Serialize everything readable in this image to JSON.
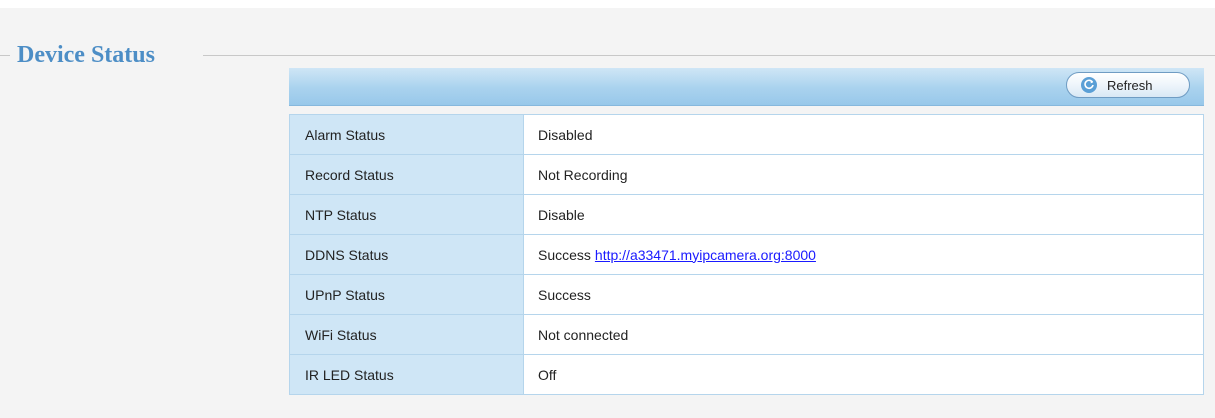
{
  "section": {
    "title": "Device Status"
  },
  "toolbar": {
    "refresh_label": "Refresh",
    "refresh_icon": "refresh-icon"
  },
  "status_rows": [
    {
      "label": "Alarm Status",
      "value": "Disabled"
    },
    {
      "label": "Record Status",
      "value": "Not Recording"
    },
    {
      "label": "NTP Status",
      "value": "Disable"
    },
    {
      "label": "DDNS Status",
      "value": "Success",
      "link": "http://a33471.myipcamera.org:8000"
    },
    {
      "label": "UPnP Status",
      "value": "Success"
    },
    {
      "label": "WiFi Status",
      "value": "Not connected"
    },
    {
      "label": "IR LED Status",
      "value": "Off"
    }
  ],
  "colors": {
    "title": "#4d8ec6",
    "label_cell_bg": "#cfe6f6",
    "border": "#b5d5ec",
    "link": "#1a1aff"
  }
}
